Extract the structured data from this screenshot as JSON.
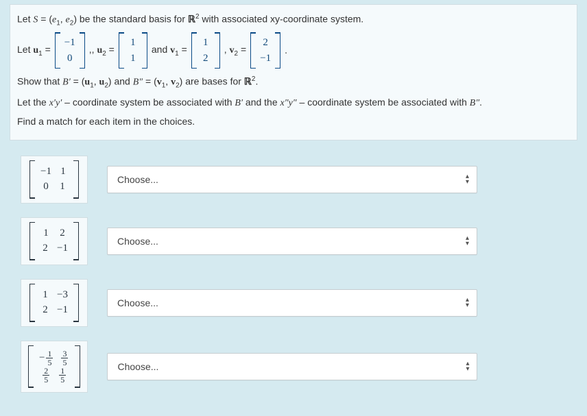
{
  "question": {
    "line1_pre": "Let ",
    "line1_S": "S",
    "line1_mid": " = (",
    "line1_e1": "e",
    "line1_s1": "1",
    "line1_comma": ", ",
    "line1_e2": "e",
    "line1_s2": "2",
    "line1_close": ")  be the standard basis for ",
    "line1_R": "ℝ",
    "line1_sq": "2",
    "line1_after": " with associated xy-coordinate system.",
    "line2_let": "Let   ",
    "line2_u1": "u",
    "line2_u1s": "1",
    "line2_eq": " = ",
    "line2_sep1": " ,, ",
    "line2_u2": "u",
    "line2_u2s": "2",
    "line2_and": "    and   ",
    "line2_v1": "v",
    "line2_v1s": "1",
    "line2_sep2": " ,  ",
    "line2_v2": "v",
    "line2_v2s": "2",
    "line2_dot": " .",
    "u1_top": "−1",
    "u1_bot": "0",
    "u2_top": "1",
    "u2_bot": "1",
    "v1_top": "1",
    "v1_bot": "2",
    "v2_top": "2",
    "v2_bot": "−1",
    "line3_pre": "Show that ",
    "line3_Bp": "B′",
    "line3_eq1": " = (",
    "line3_u1": "u",
    "line3_u1s": "1",
    "line3_c1": ", ",
    "line3_u2": "u",
    "line3_u2s": "2",
    "line3_close1": ")  and  ",
    "line3_Bpp": "B″",
    "line3_eq2": " = (",
    "line3_v1": "v",
    "line3_v1s": "1",
    "line3_c2": ", ",
    "line3_v2": "v",
    "line3_v2s": "2",
    "line3_close2": ")  are bases for ",
    "line3_R": "ℝ",
    "line3_sq": "2",
    "line3_end": ".",
    "line4a": "Let the ",
    "line4_xy1": "x′y′",
    "line4b": " – coordinate system be associated with ",
    "line4_Bp": "B′",
    "line4c": "  and the ",
    "line4_xy2": "x″y″",
    "line4d": " – coordinate system be associated with ",
    "line4_Bpp": "B″",
    "line4e": ".",
    "line5": "Find a match for each item in the choices."
  },
  "matrices": [
    {
      "rows": [
        [
          "−1",
          "1"
        ],
        [
          "0",
          "1"
        ]
      ],
      "fractions": false
    },
    {
      "rows": [
        [
          "1",
          "2"
        ],
        [
          "2",
          "−1"
        ]
      ],
      "fractions": false
    },
    {
      "rows": [
        [
          "1",
          "−3"
        ],
        [
          "2",
          "−1"
        ]
      ],
      "fractions": false
    },
    {
      "rows": [
        [
          "−1/5",
          "3/5"
        ],
        [
          "2/5",
          "1/5"
        ]
      ],
      "fractions": true,
      "row0_neg0": true
    }
  ],
  "dropdown": {
    "placeholder": "Choose..."
  },
  "chart_data": {
    "type": "table",
    "title": "Matching question: transition matrices between bases of R^2",
    "items": [
      {
        "matrix": [
          [
            -1,
            1
          ],
          [
            0,
            1
          ]
        ]
      },
      {
        "matrix": [
          [
            1,
            2
          ],
          [
            2,
            -1
          ]
        ]
      },
      {
        "matrix": [
          [
            1,
            -3
          ],
          [
            2,
            -1
          ]
        ]
      },
      {
        "matrix": [
          [
            -0.2,
            0.6
          ],
          [
            0.4,
            0.2
          ]
        ]
      }
    ],
    "answer_control": "dropdown with placeholder 'Choose...'"
  }
}
